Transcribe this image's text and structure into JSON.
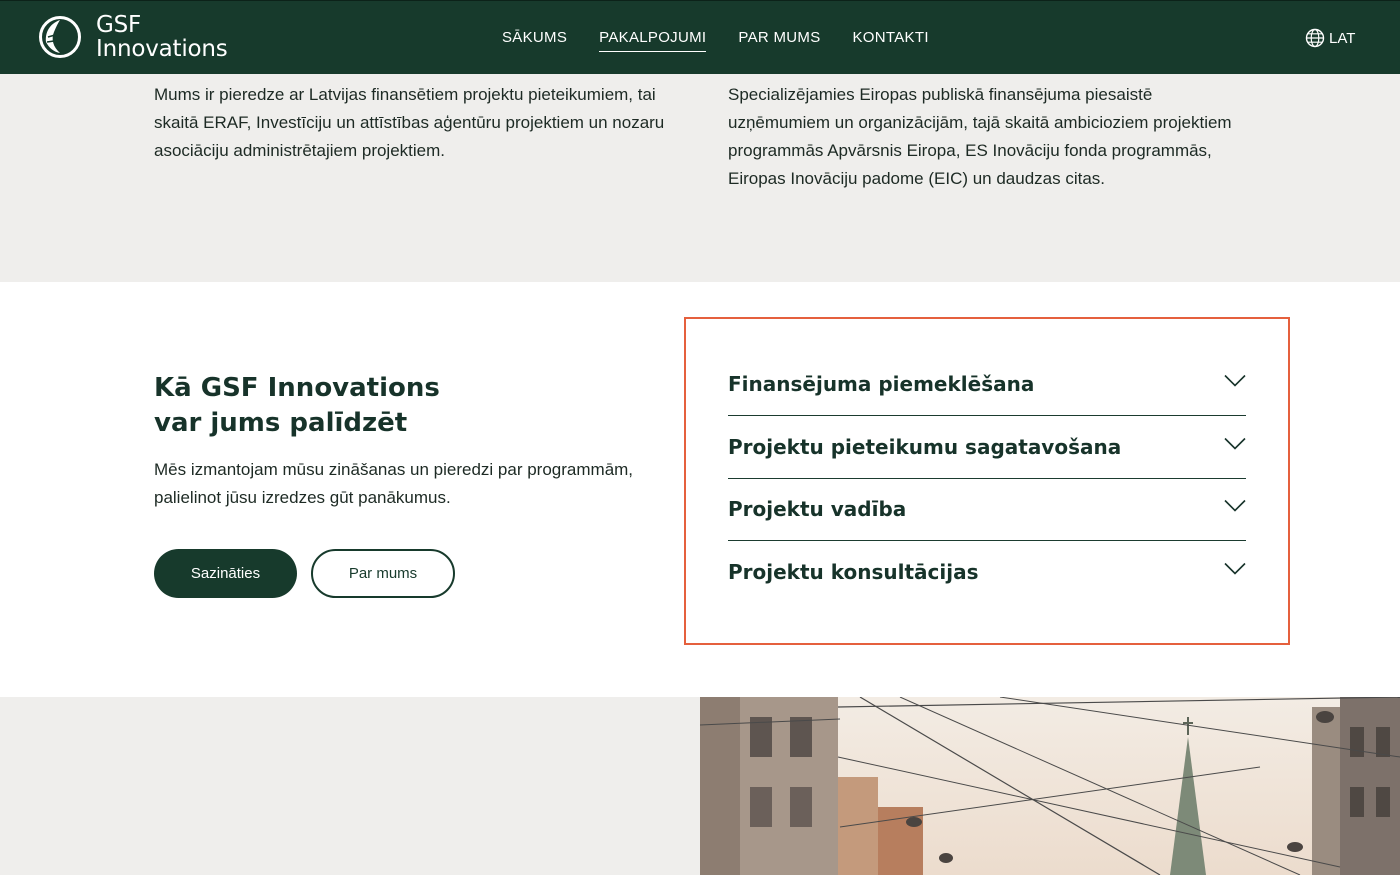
{
  "header": {
    "logo_line1": "GSF",
    "logo_line2": "Innovations",
    "nav": [
      {
        "label": "SĀKUMS"
      },
      {
        "label": "PAKALPOJUMI"
      },
      {
        "label": "PAR MUMS"
      },
      {
        "label": "KONTAKTI"
      }
    ],
    "active_nav": "PAKALPOJUMI",
    "language": "LAT"
  },
  "intro": {
    "left_text": "Mums ir pieredze ar Latvijas finansētiem projektu pieteikumiem, tai skaitā ERAF, Investīciju un attīstības aģentūru projektiem un nozaru asociāciju administrētajiem projektiem.",
    "right_text": "Specializējamies Eiropas publiskā finansējuma piesaistē uzņēmumiem un organizācijām, tajā skaitā ambicioziem projektiem programmās Apvārsnis Eiropa, ES Inovāciju fonda programmās, Eiropas Inovāciju padome (EIC) un daudzas citas."
  },
  "help": {
    "title_line1": "Kā GSF Innovations",
    "title_line2": "var jums palīdzēt",
    "description": "Mēs izmantojam mūsu zināšanas un pieredzi par programmām, palielinot jūsu izredzes gūt panākumus.",
    "primary_button": "Sazināties",
    "secondary_button": "Par mums"
  },
  "accordion": [
    {
      "label": "Finansējuma piemeklēšana"
    },
    {
      "label": "Projektu pieteikumu sagatavošana"
    },
    {
      "label": "Projektu vadība"
    },
    {
      "label": "Projektu konsultācijas"
    }
  ],
  "colors": {
    "brand_dark_green": "#173a2c",
    "band_gray": "#efeeec",
    "highlight_border": "#e5603d",
    "white": "#ffffff"
  },
  "icons": {
    "globe": "globe-icon",
    "chevron": "chevron-down-icon",
    "logo": "logo-mark-icon"
  }
}
